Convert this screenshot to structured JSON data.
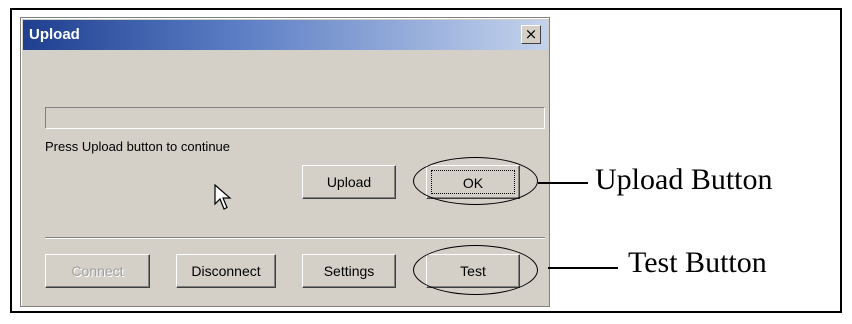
{
  "dialog": {
    "title": "Upload",
    "close_symbol": "×",
    "status_text": "Press Upload button to continue",
    "progress": 0,
    "buttons": {
      "upload": "Upload",
      "ok": "OK",
      "connect": "Connect",
      "disconnect": "Disconnect",
      "settings": "Settings",
      "test": "Test"
    }
  },
  "annotations": {
    "upload_button": "Upload Button",
    "test_button": "Test Button"
  }
}
